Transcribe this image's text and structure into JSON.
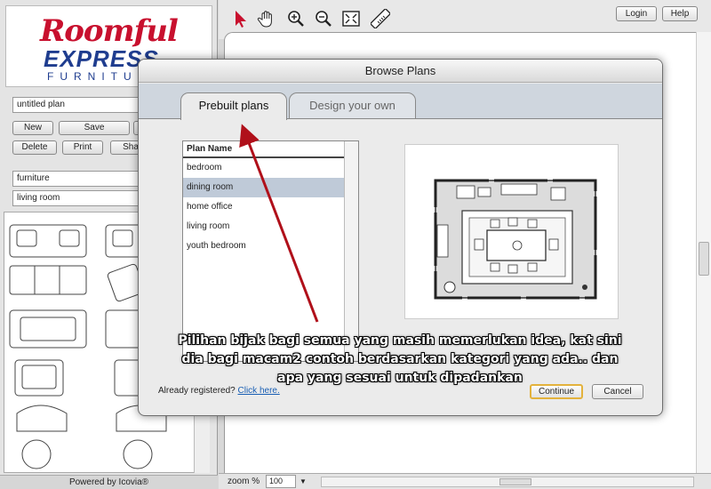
{
  "app": {
    "logo": {
      "line1": "Roomful",
      "line2": "EXPRESS",
      "line3": "FURNITU"
    },
    "plan_name_value": "untitled plan",
    "sidebar_buttons": {
      "new": "New",
      "save": "Save",
      "delete": "Delete",
      "print": "Print",
      "share": "Sha"
    },
    "category_select": "furniture",
    "room_select": "living room",
    "powered_by": "Powered by Icovia®"
  },
  "header": {
    "login": "Login",
    "help": "Help"
  },
  "toolbar_icons": [
    "pointer-icon",
    "hand-icon",
    "zoom-in-icon",
    "zoom-out-icon",
    "fit-screen-icon",
    "ruler-icon"
  ],
  "footer": {
    "zoom_label": "zoom %",
    "zoom_value": "100"
  },
  "dialog": {
    "title": "Browse Plans",
    "tabs": [
      {
        "label": "Prebuilt plans",
        "active": true
      },
      {
        "label": "Design your own",
        "active": false
      }
    ],
    "list_header": "Plan Name",
    "plans": [
      "bedroom",
      "dining room",
      "home office",
      "living room",
      "youth bedroom"
    ],
    "selected_plan": "dining room",
    "already_registered": "Already registered?",
    "click_here": "Click here.",
    "continue": "Continue",
    "cancel": "Cancel"
  },
  "annotation": {
    "caption": "Pilihan bijak bagi semua yang masih memerlukan idea, kat sini dia bagi macam2 contoh berdasarkan kategori yang ada.. dan apa yang sesuai untuk dipadankan",
    "arrow_color": "#b0101a"
  }
}
